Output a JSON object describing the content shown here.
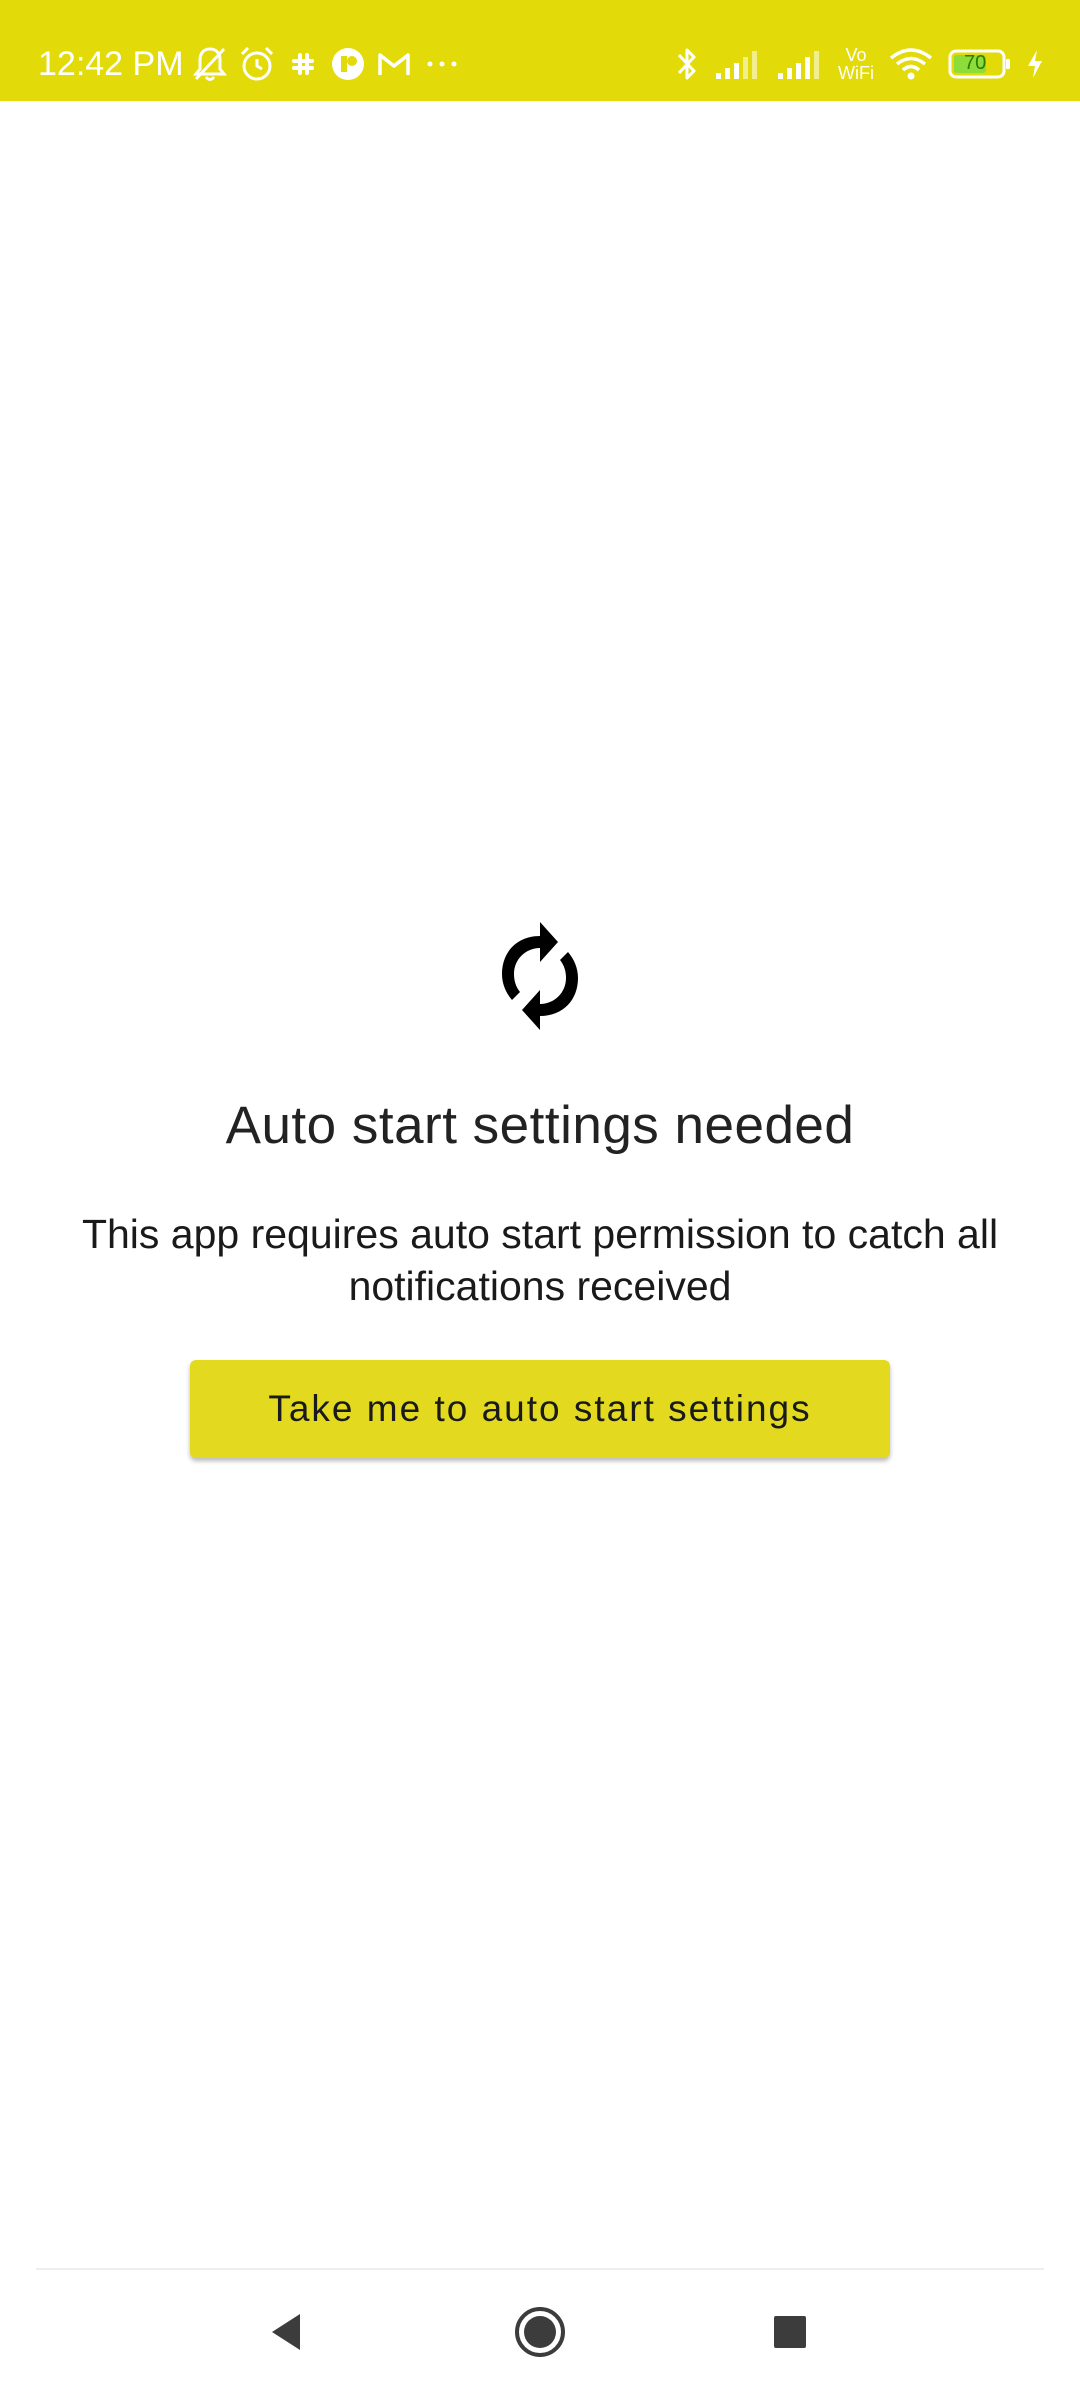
{
  "status_bar": {
    "time": "12:42 PM",
    "background_color": "#e3da09",
    "left_icons": [
      "notifications-off-icon",
      "alarm-icon",
      "slack-icon",
      "app-icon",
      "gmail-icon",
      "more-icon"
    ],
    "right_icons": [
      "bluetooth-icon",
      "signal-icon",
      "signal-icon",
      "vowifi-icon",
      "wifi-icon",
      "battery-icon",
      "charging-icon"
    ],
    "vowifi_top": "Vo",
    "vowifi_bottom": "WiFi",
    "battery_level": "70"
  },
  "main": {
    "icon": "sync-icon",
    "title": "Auto start settings needed",
    "description": "This app requires auto start permission to catch all notifications received",
    "button_label": "Take me to auto start settings",
    "accent_color": "#e3da1f"
  },
  "nav_bar": {
    "buttons": [
      "back-icon",
      "home-icon",
      "recents-icon"
    ]
  }
}
